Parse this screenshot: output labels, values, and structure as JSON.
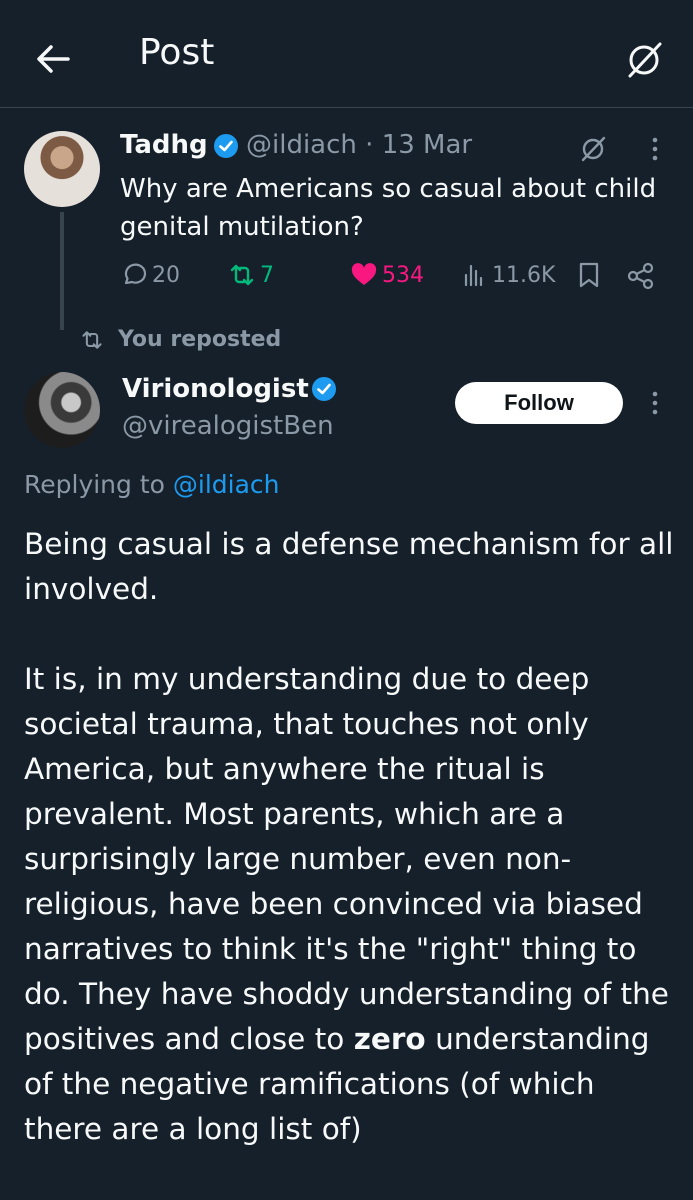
{
  "header": {
    "title": "Post"
  },
  "original_tweet": {
    "name": "Tadhg",
    "handle": "@ildiach",
    "separator": "·",
    "date": "13 Mar",
    "text": "Why are Americans so casual about child genital mutilation?",
    "stats": {
      "replies": "20",
      "reposts": "7",
      "likes": "534",
      "views": "11.6K"
    }
  },
  "repost_label": "You reposted",
  "reply_tweet": {
    "name": "Virionologist",
    "handle": "@virealogistBen",
    "follow_label": "Follow",
    "replying_prefix": "Replying to ",
    "replying_mention": "@ildiach",
    "body_part1": "Being casual is a defense mechanism for all involved.\n\nIt is, in my understanding due to deep societal trauma, that touches not only America, but anywhere the ritual is prevalent.  Most parents, which are a surprisingly large number, even non-religious, have been convinced via biased narratives to think it's the \"right\" thing to do.  They have shoddy understanding of the positives and close to ",
    "body_bold": "zero",
    "body_part2": " understanding of the negative ramifications (of which there are a long list of)"
  },
  "colors": {
    "background": "#15202b",
    "text": "#f7f9f9",
    "secondary": "#8b98a5",
    "accent": "#1d9bf0",
    "repost_green": "#00ba7c",
    "like_pink": "#f91880"
  },
  "icons": [
    "back-arrow-icon",
    "grok-icon",
    "verified-badge-icon",
    "more-icon",
    "reply-icon",
    "repost-icon",
    "heart-icon",
    "views-icon",
    "bookmark-icon",
    "share-icon"
  ]
}
